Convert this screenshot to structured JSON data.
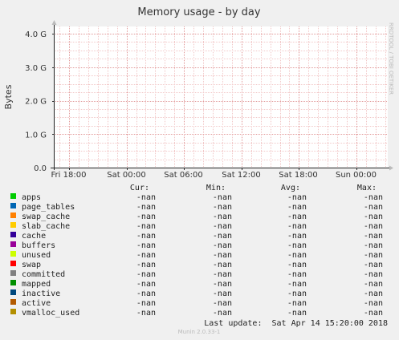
{
  "chart_data": {
    "type": "line",
    "title": "Memory usage - by day",
    "ylabel": "Bytes",
    "side_text": "RRDTOOL / TOBI OETIKER",
    "ylim": [
      0,
      4.0
    ],
    "y_unit": "G",
    "y_ticks": [
      {
        "value": 0,
        "label": "0.0"
      },
      {
        "value": 1,
        "label": "1.0 G"
      },
      {
        "value": 2,
        "label": "2.0 G"
      },
      {
        "value": 3,
        "label": "3.0 G"
      },
      {
        "value": 4,
        "label": "4.0 G"
      }
    ],
    "x_ticks": [
      {
        "hours": 0,
        "label": "Fri 18:00"
      },
      {
        "hours": 6,
        "label": "Sat 00:00"
      },
      {
        "hours": 12,
        "label": "Sat 06:00"
      },
      {
        "hours": 18,
        "label": "Sat 12:00"
      },
      {
        "hours": 24,
        "label": "Sat 18:00"
      },
      {
        "hours": 30,
        "label": "Sun 00:00"
      }
    ],
    "grid": true,
    "columns": [
      "Cur:",
      "Min:",
      "Avg:",
      "Max:"
    ],
    "series": [
      {
        "name": "apps",
        "color": "#00cc00",
        "cur": "-nan",
        "min": "-nan",
        "avg": "-nan",
        "max": "-nan"
      },
      {
        "name": "page_tables",
        "color": "#0066b3",
        "cur": "-nan",
        "min": "-nan",
        "avg": "-nan",
        "max": "-nan"
      },
      {
        "name": "swap_cache",
        "color": "#ff8000",
        "cur": "-nan",
        "min": "-nan",
        "avg": "-nan",
        "max": "-nan"
      },
      {
        "name": "slab_cache",
        "color": "#ffcc00",
        "cur": "-nan",
        "min": "-nan",
        "avg": "-nan",
        "max": "-nan"
      },
      {
        "name": "cache",
        "color": "#330099",
        "cur": "-nan",
        "min": "-nan",
        "avg": "-nan",
        "max": "-nan"
      },
      {
        "name": "buffers",
        "color": "#990099",
        "cur": "-nan",
        "min": "-nan",
        "avg": "-nan",
        "max": "-nan"
      },
      {
        "name": "unused",
        "color": "#ccff00",
        "cur": "-nan",
        "min": "-nan",
        "avg": "-nan",
        "max": "-nan"
      },
      {
        "name": "swap",
        "color": "#ff0000",
        "cur": "-nan",
        "min": "-nan",
        "avg": "-nan",
        "max": "-nan"
      },
      {
        "name": "committed",
        "color": "#808080",
        "cur": "-nan",
        "min": "-nan",
        "avg": "-nan",
        "max": "-nan"
      },
      {
        "name": "mapped",
        "color": "#008f00",
        "cur": "-nan",
        "min": "-nan",
        "avg": "-nan",
        "max": "-nan"
      },
      {
        "name": "inactive",
        "color": "#00487d",
        "cur": "-nan",
        "min": "-nan",
        "avg": "-nan",
        "max": "-nan"
      },
      {
        "name": "active",
        "color": "#b35a00",
        "cur": "-nan",
        "min": "-nan",
        "avg": "-nan",
        "max": "-nan"
      },
      {
        "name": "vmalloc_used",
        "color": "#b38f00",
        "cur": "-nan",
        "min": "-nan",
        "avg": "-nan",
        "max": "-nan"
      }
    ],
    "last_update": "Last update:  Sat Apr 14 15:20:00 2018",
    "footer": "Munin 2.0.33-1"
  }
}
